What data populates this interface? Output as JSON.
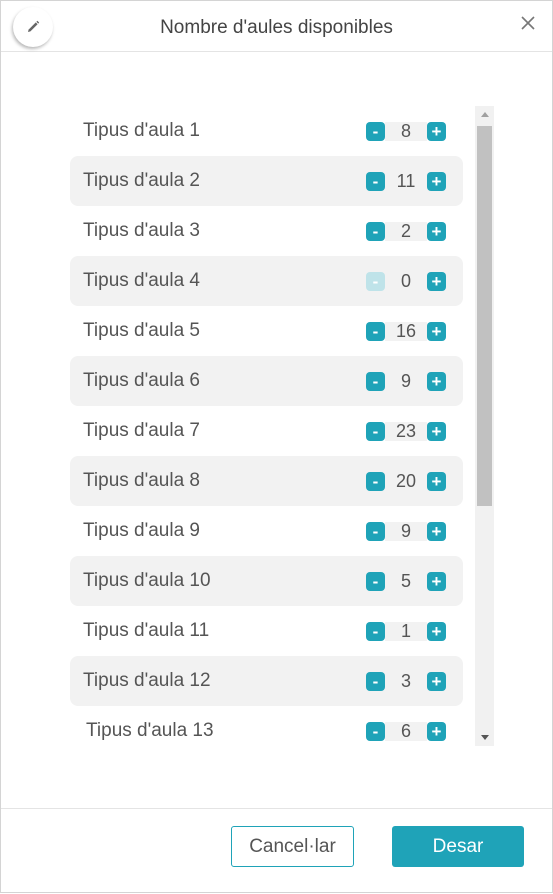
{
  "dialog": {
    "title": "Nombre d'aules disponibles",
    "edit_icon": "pencil-icon",
    "close_icon": "close-icon"
  },
  "rows": [
    {
      "label": "Tipus d'aula 1",
      "value": "8",
      "minus_enabled": true
    },
    {
      "label": "Tipus d'aula 2",
      "value": "11",
      "minus_enabled": true
    },
    {
      "label": "Tipus d'aula 3",
      "value": "2",
      "minus_enabled": true
    },
    {
      "label": "Tipus d'aula 4",
      "value": "0",
      "minus_enabled": false
    },
    {
      "label": "Tipus d'aula 5",
      "value": "16",
      "minus_enabled": true
    },
    {
      "label": "Tipus d'aula 6",
      "value": "9",
      "minus_enabled": true
    },
    {
      "label": "Tipus d'aula 7",
      "value": "23",
      "minus_enabled": true
    },
    {
      "label": "Tipus d'aula 8",
      "value": "20",
      "minus_enabled": true
    },
    {
      "label": "Tipus d'aula 9",
      "value": "9",
      "minus_enabled": true
    },
    {
      "label": "Tipus d'aula 10",
      "value": "5",
      "minus_enabled": true
    },
    {
      "label": "Tipus d'aula 11",
      "value": "1",
      "minus_enabled": true
    },
    {
      "label": "Tipus d'aula 12",
      "value": "3",
      "minus_enabled": true
    },
    {
      "label": "Tipus d'aula 13",
      "value": "6",
      "minus_enabled": true
    }
  ],
  "stepper": {
    "minus_symbol": "-",
    "plus_symbol": "+"
  },
  "footer": {
    "cancel_label": "Cancel·lar",
    "save_label": "Desar"
  },
  "colors": {
    "accent": "#1fa3b8",
    "accent_disabled": "#bfe3e9",
    "row_alt": "#f2f2f2",
    "text": "#555555"
  }
}
